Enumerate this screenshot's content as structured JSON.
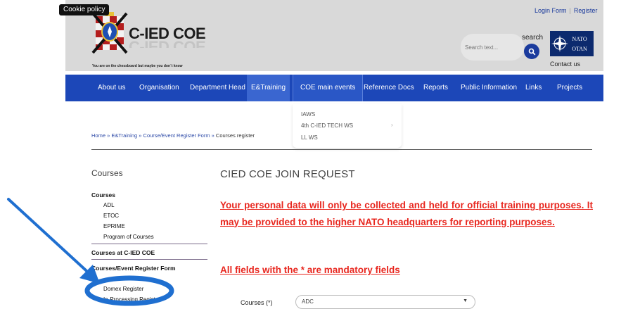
{
  "cookie": "Cookie policy",
  "top_links": {
    "login": "Login Form",
    "sep": "|",
    "register": "Register"
  },
  "logo": {
    "title": "C-IED COE",
    "ghost": "C-IED COE",
    "tagline": "You are on the chessboard but maybe you don´t know"
  },
  "search": {
    "label": "search",
    "placeholder": "Search text..."
  },
  "nato": {
    "top": "NATO",
    "bottom": "OTAN"
  },
  "contact": "Contact us",
  "nav": {
    "items": [
      "About us",
      "Organisation",
      "Department Head",
      "E&Training",
      "COE main events",
      "Reference Docs",
      "Reports",
      "Public Information",
      "Links",
      "Projects"
    ]
  },
  "dropdown": {
    "items": [
      "IAWS",
      "4th C-IED TECH WS",
      "LL WS"
    ]
  },
  "breadcrumb": {
    "home": "Home",
    "training": "E&Training",
    "form": "Course/Event Register Form",
    "current": "Courses register"
  },
  "sidebar": {
    "title": "Courses",
    "group1": "Courses",
    "group1_items": [
      "ADL",
      "ETOC",
      "EPRIME",
      "Program of Courses"
    ],
    "group2": "Courses at C-IED COE",
    "group3": "Courses/Event Register Form",
    "group3_items": [
      "Domex Register",
      "In-Processing Register"
    ]
  },
  "main": {
    "title": "CIED COE JOIN REQUEST",
    "notice": "Your personal data will only be collected and held for official training purposes. It may be provided to the higher NATO headquarters for reporting purposes.",
    "mandatory": "All fields with the * are mandatory fields",
    "courses_label": "Courses (*)",
    "courses_value": "ADC"
  },
  "colors": {
    "nav": "#1c47b8",
    "nav_active": "#3a66d0",
    "header": "#d9d9d9",
    "alert_red": "#e8271f",
    "annotation_blue": "#1f6fd0"
  },
  "icons": [
    "search-icon",
    "dropdown-arrow-icon",
    "chevron-right-icon",
    "annotation-arrow-icon",
    "annotation-circle-icon"
  ]
}
